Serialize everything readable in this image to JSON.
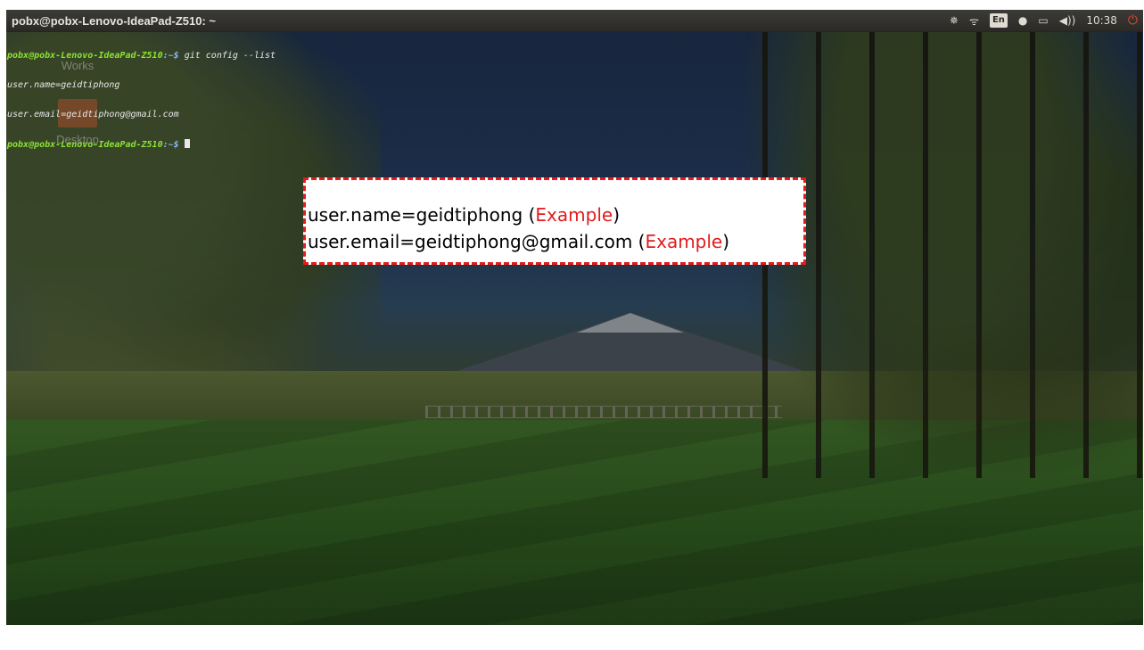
{
  "window": {
    "title": "pobx@pobx-Lenovo-IdeaPad-Z510: ~"
  },
  "panel": {
    "indicators": [
      {
        "name": "network-settings-icon",
        "glyph": "✵"
      },
      {
        "name": "wifi-icon",
        "glyph": "ᯤ"
      },
      {
        "name": "keyboard-layout",
        "glyph": "En"
      },
      {
        "name": "messaging-icon",
        "glyph": "●"
      },
      {
        "name": "battery-icon",
        "glyph": "▭"
      },
      {
        "name": "volume-icon",
        "glyph": "◀))"
      }
    ],
    "clock": "10:38",
    "power_glyph": "⏻"
  },
  "terminal": {
    "line1_prompt": "pobx@pobx-Lenovo-IdeaPad-Z510",
    "line1_path": ":~$",
    "line1_command": " git config --list",
    "line2": "user.name=geidtiphong",
    "line3": "user.email=geidtiphong@gmail.com",
    "line4_prompt": "pobx@pobx-Lenovo-IdeaPad-Z510",
    "line4_path": ":~$"
  },
  "desktop": {
    "icons": [
      {
        "label": "Works"
      },
      {
        "label": "Desktop"
      }
    ]
  },
  "callout": {
    "line1_text": "user.name=geidtiphong (",
    "line1_example": "Example",
    "line1_close": ")",
    "line2_text": "user.email=geidtiphong@gmail.com (",
    "line2_example": "Example",
    "line2_close": ")"
  },
  "colors": {
    "panel_bg": "#2b2a27",
    "prompt_green": "#8ae234",
    "accent_red": "#e31b1b",
    "power_red": "#e24a2a"
  }
}
